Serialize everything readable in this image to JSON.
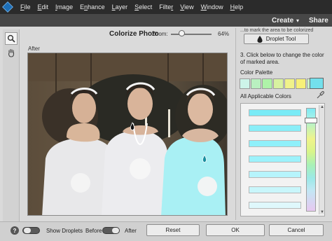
{
  "menu": {
    "items": [
      {
        "pre": "",
        "u": "F",
        "post": "ile"
      },
      {
        "pre": "",
        "u": "E",
        "post": "dit"
      },
      {
        "pre": "",
        "u": "I",
        "post": "mage"
      },
      {
        "pre": "E",
        "u": "n",
        "post": "hance"
      },
      {
        "pre": "",
        "u": "L",
        "post": "ayer"
      },
      {
        "pre": "",
        "u": "S",
        "post": "elect"
      },
      {
        "pre": "Filte",
        "u": "r",
        "post": ""
      },
      {
        "pre": "",
        "u": "V",
        "post": "iew"
      },
      {
        "pre": "",
        "u": "W",
        "post": "indow"
      },
      {
        "pre": "",
        "u": "H",
        "post": "elp"
      }
    ]
  },
  "topbar": {
    "create_label": "Create",
    "create_caret": "▾",
    "share_label": "Share"
  },
  "tools": {
    "zoom_icon": "magnifier-icon",
    "hand_icon": "hand-icon"
  },
  "header": {
    "title": "Colorize Photo",
    "zoom_label": "Zoom:",
    "zoom_value": "64%",
    "zoom_level": 0.27
  },
  "view": {
    "after_label": "After"
  },
  "right_panel": {
    "hint_top": "...to mark the area to be colorized",
    "droplet_tool_label": "Droplet Tool",
    "droplet_icon": "droplet-icon",
    "step3_text": "3. Click below to change the color of marked area.",
    "palette_label": "Color Palette",
    "palette_colors": [
      "#cdf4e9",
      "#b9f0c0",
      "#aef3a8",
      "#d8f2a0",
      "#f0f28a",
      "#f7f078",
      "#c8f2c8"
    ],
    "palette_selected": "#73e0ec",
    "applicable_label": "All Applicable Colors",
    "eyedropper_icon": "eyedropper-icon",
    "applicable_colors": [
      "#79ebf6",
      "#8aeef8",
      "#8ff0fa",
      "#9df2fb",
      "#b6f4fc",
      "#c9f6fb",
      "#dff8fc"
    ]
  },
  "bottom": {
    "help_label": "?",
    "show_droplets_label": "Show Droplets",
    "before_label": "Before",
    "after_label": "After",
    "reset_label": "Reset",
    "ok_label": "OK",
    "cancel_label": "Cancel"
  }
}
